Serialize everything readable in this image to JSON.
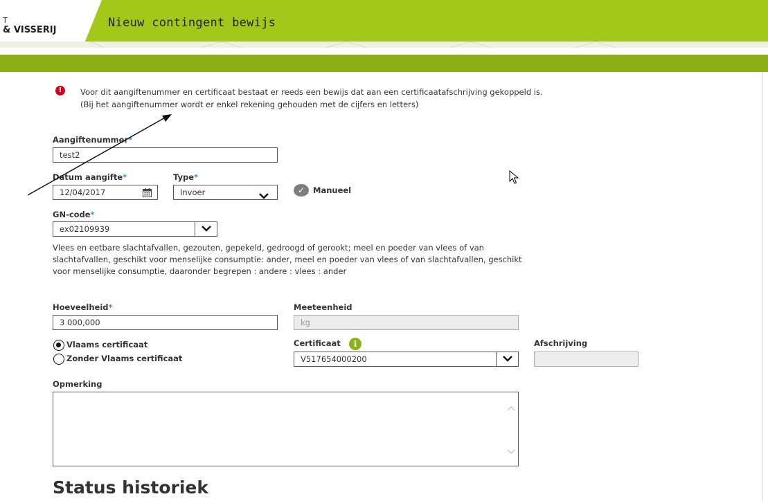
{
  "header": {
    "logo_top": "T",
    "logo_text": "& VISSERIJ",
    "title": "Nieuw contingent bewijs"
  },
  "alert": {
    "line1": "Voor dit aangiftenummer en certificaat bestaat er reeds een bewijs dat aan een certificaatafschrijving gekoppeld is.",
    "line2": "(Bij het aangiftenummer wordt er enkel rekening gehouden met de cijfers en letters)",
    "icon": "exclamation-circle",
    "color": "#d0021b"
  },
  "form": {
    "aangiftenummer": {
      "label": "Aangiftenummer",
      "required_mark": "*",
      "value": "test2"
    },
    "datum": {
      "label": "Datum aangifte",
      "required_mark": "*",
      "value": "12/04/2017"
    },
    "type": {
      "label": "Type",
      "required_mark": "*",
      "value": "Invoer"
    },
    "manueel": {
      "label": "Manueel"
    },
    "gn_code": {
      "label": "GN-code",
      "required_mark": "*",
      "value": "ex02109939"
    },
    "gn_description": "Vlees en eetbare slachtafvallen, gezouten, gepekeld, gedroogd of gerookt; meel en poeder van vlees of van slachtafvallen, geschikt voor menselijke consumptie: ander, meel en poeder van vlees of van slachtafvallen, geschikt voor menselijke consumptie, daaronder begrepen : andere : vlees : ander",
    "hoeveelheid": {
      "label": "Hoeveelheid",
      "required_mark": "*",
      "value": "3 000,000"
    },
    "meeteenheid": {
      "label": "Meeteenheid",
      "value": "kg"
    },
    "radio_vlaams": {
      "label": "Vlaams certificaat",
      "checked": true
    },
    "radio_zonder": {
      "label": "Zonder Vlaams certificaat",
      "checked": false
    },
    "certificaat": {
      "label": "Certificaat",
      "value": "V517654000200",
      "icon": "i"
    },
    "afschrijving": {
      "label": "Afschrijving",
      "value": ""
    },
    "opmerking": {
      "label": "Opmerking",
      "value": ""
    }
  },
  "status_title": "Status historiek",
  "colors": {
    "header_green": "#a4c81a",
    "band_green": "#8aae14",
    "required": "#2a9fd6"
  }
}
